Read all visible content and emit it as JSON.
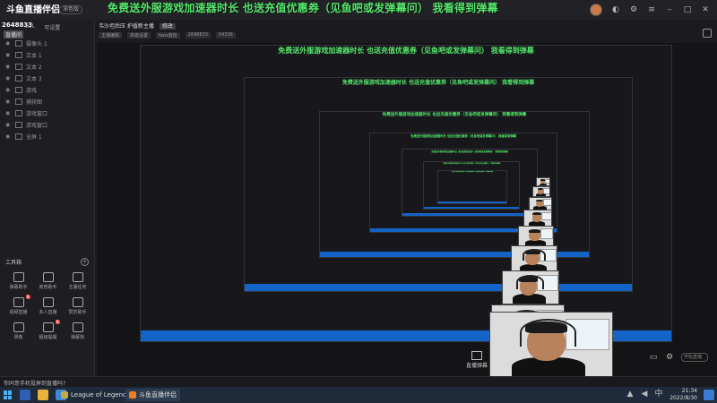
{
  "app": {
    "logo_text": "斗鱼直播伴侣",
    "logo_badge": "深色版",
    "viewer_count": "2648833",
    "fanclub_label": "直播间"
  },
  "banner": {
    "text": "免费送外服游戏加速器时长  也送充值优惠券（见鱼吧或发弹幕问）      我看得到弹幕"
  },
  "left_panel": {
    "tabs": [
      "LOL",
      "可设置"
    ],
    "scenes": [
      {
        "label": "摄像头 1"
      },
      {
        "label": "文本 1"
      },
      {
        "label": "文本 2"
      },
      {
        "label": "文本 3"
      },
      {
        "label": "游戏"
      },
      {
        "label": "捕获图"
      },
      {
        "label": "游戏窗口"
      },
      {
        "label": "游戏窗口"
      },
      {
        "label": "全屏 1"
      }
    ],
    "tools_title": "工具箱",
    "tools": [
      {
        "label": "弹幕助手",
        "new": false
      },
      {
        "label": "房管助手",
        "new": false
      },
      {
        "label": "主播任务",
        "new": false
      },
      {
        "label": "视频直播",
        "new": true
      },
      {
        "label": "多人直播",
        "new": false
      },
      {
        "label": "赞赏助手",
        "new": false
      },
      {
        "label": "录像",
        "new": false
      },
      {
        "label": "超级提醒",
        "new": true
      },
      {
        "label": "弹幕狗",
        "new": false
      }
    ]
  },
  "live_header": {
    "title": "韦沙坦后压 护盾新主播",
    "edit_label": "修改",
    "tags": [
      "主播编辑",
      "高级设置",
      "fans值班",
      "2648833",
      "54336"
    ]
  },
  "bottom_hint": "你同意手机投屏到直播吗?",
  "stage_controls": {
    "danmu_label": "直播弹幕",
    "search_placeholder": "开始直播"
  },
  "taskbar": {
    "apps": [
      {
        "label": "League of Legends",
        "color": "#c8a94a"
      },
      {
        "label": "斗鱼直播伴侣",
        "color": "#f07c22"
      }
    ],
    "time": "21:34",
    "date": "2022/8/30"
  },
  "colors": {
    "banner": "#53e86a",
    "taskbar_blue": "#1464c8",
    "accent": "#f07c22"
  }
}
